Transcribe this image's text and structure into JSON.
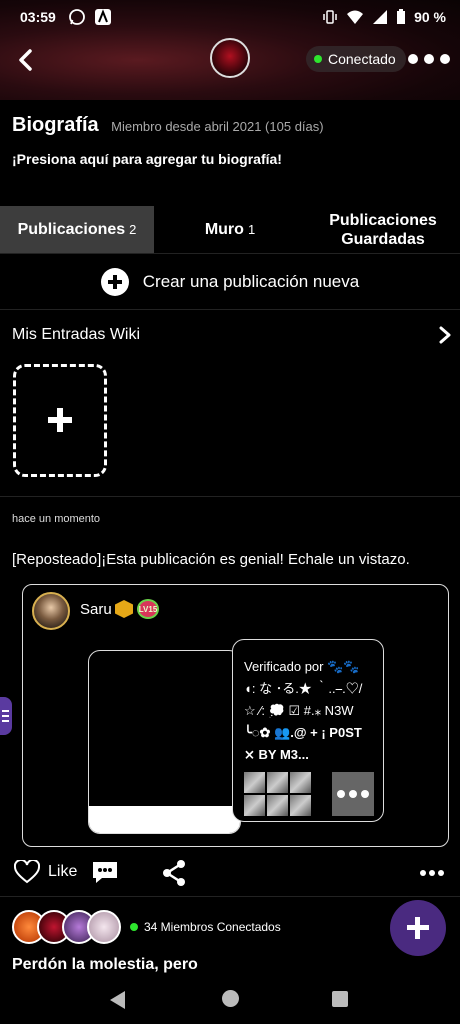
{
  "statusbar": {
    "time": "03:59",
    "battery": "90 %"
  },
  "header": {
    "status_label": "Conectado"
  },
  "bio": {
    "title": "Biografía",
    "member_since": "Miembro desde abril 2021 (105 días)",
    "cta": "¡Presiona aquí para agregar tu biografía!"
  },
  "tabs": [
    {
      "label": "Publicaciones",
      "count": "2"
    },
    {
      "label": "Muro",
      "count": "1"
    },
    {
      "label": "Publicaciones Guardadas",
      "count": ""
    }
  ],
  "create_post": {
    "label": "Crear una publicación nueva"
  },
  "wiki": {
    "title": "Mis Entradas Wiki"
  },
  "post": {
    "time": "hace un momento",
    "text": "[Reposteado]¡Esta publicación es genial! Echale un vistazo.",
    "repost": {
      "author": "Saru",
      "level": "LV15",
      "card_lines": [
        "Verificado por 🐾🐾",
        "◖: な ･る.★ ‵..⎯.♡/",
        "☆ ⁄: 💭 ☑ #.⁎ N3W",
        "╰◌✿ 👥.@ + ¡ P0ST",
        "⨯ BY M3..."
      ]
    },
    "like_label": "Like"
  },
  "members": {
    "count_label": "34 Miembros Conectados"
  },
  "next_post": {
    "title": "Perdón la molestia, pero"
  },
  "colors": {
    "accent": "#4a2a80",
    "online": "#2ee52e",
    "active_tab": "#3d3d3d"
  },
  "icons": [
    "back-arrow-icon",
    "more-icon",
    "plus-circle-icon",
    "chevron-right-icon",
    "heart-icon",
    "comment-icon",
    "share-icon",
    "plus-icon"
  ]
}
